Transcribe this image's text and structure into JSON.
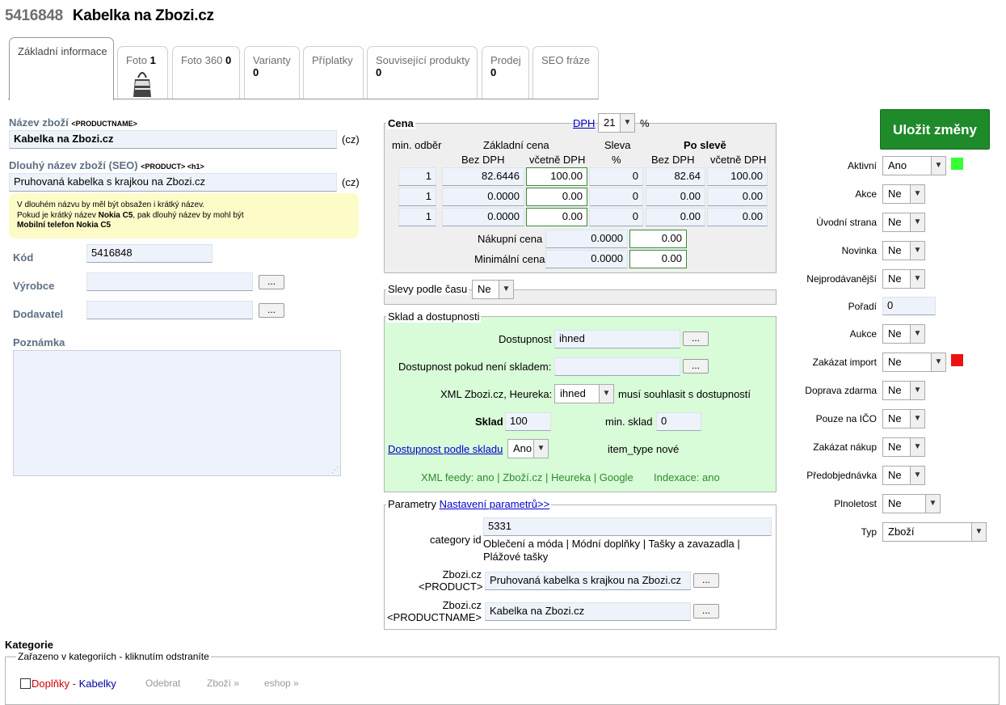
{
  "header": {
    "product_id": "5416848",
    "title": "Kabelka na Zbozi.cz"
  },
  "tabs": [
    {
      "label": "Základní informace",
      "count": ""
    },
    {
      "label": "Foto",
      "count": "1"
    },
    {
      "label": "Foto 360",
      "count": "0"
    },
    {
      "label": "Varianty",
      "count": "0"
    },
    {
      "label": "Příplatky",
      "count": ""
    },
    {
      "label": "Související produkty",
      "count": "0"
    },
    {
      "label": "Prodej",
      "count": "0"
    },
    {
      "label": "SEO fráze",
      "count": ""
    }
  ],
  "left": {
    "name_label": "Název zboží",
    "name_tag": "<PRODUCTNAME>",
    "name_value": "Kabelka na Zbozi.cz",
    "lang": "(cz)",
    "long_label": "Dlouhý název zboží (SEO)",
    "long_tag": "<PRODUCT> <h1>",
    "long_value": "Pruhovaná kabelka s krajkou na Zbozi.cz",
    "note_line1": "V dlouhém názvu by měl být obsažen i krátký název.",
    "note_line2a": "Pokud je krátký název ",
    "note_line2b": "Nokia C5",
    "note_line2c": ", pak dlouhý název by mohl být",
    "note_line3": "Mobilní telefon Nokia C5",
    "code_label": "Kód",
    "code_value": "5416848",
    "maker_label": "Výrobce",
    "supplier_label": "Dodavatel",
    "dots": "...",
    "memo_label": "Poznámka"
  },
  "price": {
    "legend": "Cena",
    "vat_link": "DPH",
    "vat_value": "21",
    "pct": "%",
    "h_min": "min. odběr",
    "h_base": "Základní cena",
    "h_disc": "Sleva",
    "h_after": "Po slevě",
    "h_nov": "Bez DPH",
    "h_vat": "včetně DPH",
    "h_pct": "%",
    "h_nov2": "Bez DPH",
    "h_vat2": "včetně DPH",
    "rows": [
      {
        "min": "1",
        "base": "82.6446",
        "basevat": "100.00",
        "disc": "0",
        "after": "82.64",
        "aftervat": "100.00"
      },
      {
        "min": "1",
        "base": "0.0000",
        "basevat": "0.00",
        "disc": "0",
        "after": "0.00",
        "aftervat": "0.00"
      },
      {
        "min": "1",
        "base": "0.0000",
        "basevat": "0.00",
        "disc": "0",
        "after": "0.00",
        "aftervat": "0.00"
      }
    ],
    "buy_label": "Nákupní cena",
    "buy_value": "0.0000",
    "buy_vat": "0.00",
    "minp_label": "Minimální cena",
    "minp_value": "0.0000",
    "minp_vat": "0.00"
  },
  "timed": {
    "label": "Slevy podle času",
    "value": "Ne"
  },
  "stock": {
    "legend": "Sklad a dostupnosti",
    "avail_label": "Dostupnost",
    "avail_value": "ihned",
    "avail_out_label": "Dostupnost pokud není skladem:",
    "xml_label": "XML Zbozi.cz, Heureka:",
    "xml_value": "ihned",
    "xml_note": "musí souhlasit s dostupností",
    "stock_label": "Sklad",
    "stock_value": "100",
    "minstock_label": "min. sklad",
    "minstock_value": "0",
    "bystock_link": "Dostupnost podle skladu",
    "bystock_value": "Ano",
    "itemtype_label": "item_type",
    "itemtype_value": "nové",
    "feeds": "XML feedy: ano |",
    "feed1": "Zboží.cz",
    "sep": "|",
    "feed2": "Heureka",
    "feed3": "Google",
    "index": "Indexace: ano"
  },
  "params": {
    "legend": "Parametry",
    "link": "Nastavení parametrů>>",
    "cat_label": "category id",
    "cat_value": "5331",
    "cat_path1": "Oblečení a móda | Módní doplňky | Tašky a zavazadla |",
    "cat_path2": "Plážové tašky",
    "prod_label1": "Zbozi.cz",
    "prod_label2": "<PRODUCT>",
    "prod_value": "Pruhovaná kabelka s krajkou na Zbozi.cz",
    "pn_label1": "Zbozi.cz",
    "pn_label2": "<PRODUCTNAME>",
    "pn_value": "Kabelka na Zbozi.cz"
  },
  "right": {
    "save": "Uložit změny",
    "active_label": "Aktivní",
    "active_value": "Ano",
    "akce_label": "Akce",
    "akce_value": "Ne",
    "home_label": "Úvodní strana",
    "home_value": "Ne",
    "new_label": "Novinka",
    "new_value": "Ne",
    "best_label": "Nejprodávanější",
    "best_value": "Ne",
    "order_label": "Pořadí",
    "order_value": "0",
    "auction_label": "Aukce",
    "auction_value": "Ne",
    "import_label": "Zakázat import",
    "import_value": "Ne",
    "ship_label": "Doprava zdarma",
    "ship_value": "Ne",
    "ico_label": "Pouze na IČO",
    "ico_value": "Ne",
    "buy_label": "Zakázat nákup",
    "buy_value": "Ne",
    "pre_label": "Předobjednávka",
    "pre_value": "Ne",
    "adult_label": "Plnoletost",
    "adult_value": "Ne",
    "type_label": "Typ",
    "type_value": "Zboží",
    "colors": {
      "active": "#33ff33",
      "import": "#ee1111"
    }
  },
  "categories": {
    "heading": "Kategorie",
    "legend": "Zařazeno v kategoriích - kliknutím odstraníte",
    "cat_a": "Doplňky",
    "dash": "-",
    "cat_b": "Kabelky",
    "remove": "Odebrat",
    "goods": "Zboží »",
    "eshop": "eshop »"
  }
}
